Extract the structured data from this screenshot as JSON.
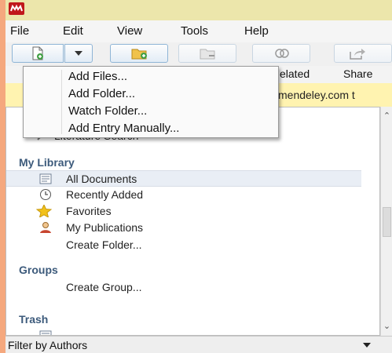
{
  "menu": [
    "File",
    "Edit",
    "View",
    "Tools",
    "Help"
  ],
  "toolbar_labels": {
    "related": "elated",
    "share": "Share"
  },
  "banner_text": "mendeley.com t",
  "add_menu": [
    "Add Files...",
    "Add Folder...",
    "Watch Folder...",
    "Add Entry Manually..."
  ],
  "sidebar": {
    "partial_top": "Literature Search",
    "my_library_heading": "My Library",
    "my_library_items": [
      {
        "label": "All Documents",
        "icon": "documents-icon"
      },
      {
        "label": "Recently Added",
        "icon": "clock-icon"
      },
      {
        "label": "Favorites",
        "icon": "star-icon"
      },
      {
        "label": "My Publications",
        "icon": "user-icon"
      },
      {
        "label": "Create Folder...",
        "icon": ""
      }
    ],
    "groups_heading": "Groups",
    "create_group": "Create Group...",
    "trash_heading": "Trash"
  },
  "filter": {
    "label": "Filter by Authors"
  },
  "colors": {
    "accent": "#3c5a7b",
    "banner": "#fff3b0",
    "titlebar": "#ece6ab",
    "logo": "#c0171b"
  }
}
